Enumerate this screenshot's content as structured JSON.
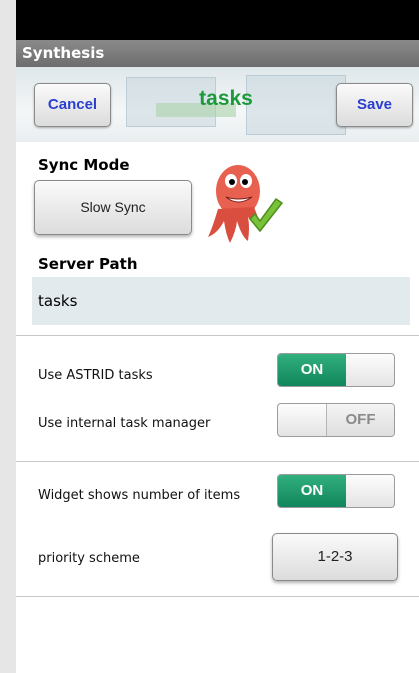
{
  "window": {
    "title": "Synthesis"
  },
  "header": {
    "cancel_label": "Cancel",
    "title": "tasks",
    "save_label": "Save"
  },
  "sync": {
    "label": "Sync Mode",
    "value": "Slow Sync"
  },
  "server": {
    "label": "Server Path",
    "value": "tasks"
  },
  "settings": [
    {
      "label": "Use ASTRID tasks",
      "state": "ON"
    },
    {
      "label": "Use internal task manager",
      "state": "OFF"
    },
    {
      "label": "Widget shows number of items",
      "state": "ON"
    }
  ],
  "priority": {
    "label": "priority scheme",
    "value": "1-2-3"
  },
  "colors": {
    "accent_green": "#1c9a3a",
    "toggle_on": "#12855c",
    "button_text_blue": "#2a3fd0"
  },
  "icons": {
    "mascot": "octopus-mascot-with-checkmark-icon"
  }
}
